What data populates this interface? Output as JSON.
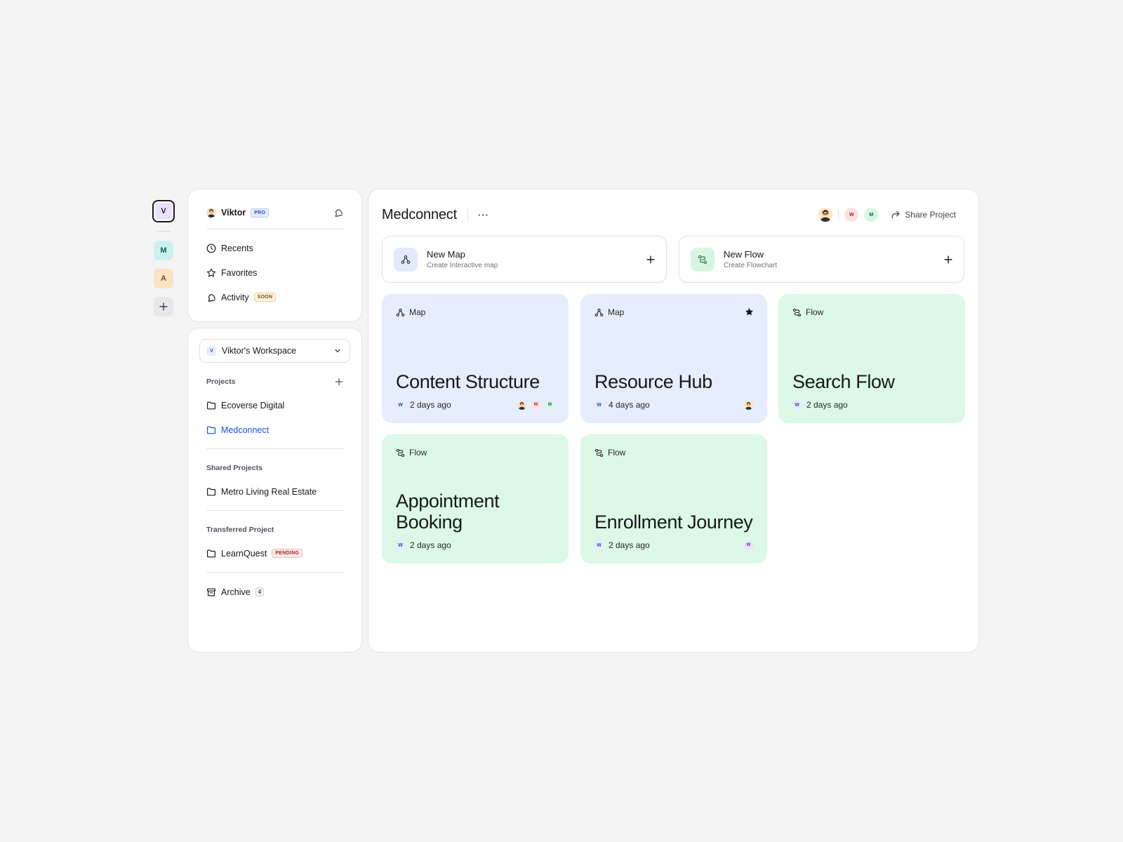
{
  "rail": {
    "workspaces": [
      {
        "initial": "V",
        "color": "#e9e1fb"
      },
      {
        "initial": "M",
        "color": "#cdf1f1"
      },
      {
        "initial": "A",
        "color": "#fbe3c4"
      }
    ],
    "add_icon": "plus-icon"
  },
  "sidebar": {
    "user": {
      "name": "Viktor",
      "plan_badge": "PRO",
      "notification_icon": "bell-icon"
    },
    "nav": [
      {
        "label": "Recents",
        "icon": "clock-icon"
      },
      {
        "label": "Favorites",
        "icon": "star-icon"
      },
      {
        "label": "Activity",
        "icon": "bell-icon",
        "badge": "SOON"
      }
    ],
    "workspace_select": {
      "initial": "V",
      "label": "Viktor's Workspace"
    },
    "projects": {
      "heading": "Projects",
      "items": [
        "Ecoverse Digital",
        "Medconnect"
      ],
      "active": "Medconnect"
    },
    "shared": {
      "heading": "Shared Projects",
      "items": [
        "Metro Living Real Estate"
      ]
    },
    "transferred": {
      "heading": "Transferred Project",
      "items": [
        {
          "label": "LearnQuest",
          "badge": "PENDING"
        }
      ]
    },
    "archive": {
      "label": "Archive",
      "count": "4"
    }
  },
  "main": {
    "title": "Medconnect",
    "more_label": "···",
    "collaborators": [
      "W",
      "M"
    ],
    "share_label": "Share Project",
    "actions": [
      {
        "title": "New Map",
        "subtitle": "Create Interactive map",
        "icon": "map-icon"
      },
      {
        "title": "New Flow",
        "subtitle": "Create Flowchart",
        "icon": "flow-icon"
      }
    ],
    "cards": [
      {
        "type": "Map",
        "title": "Content Structure",
        "workspace": "W",
        "time": "2 days ago",
        "avatars": [
          "photo",
          "W",
          "M"
        ],
        "starred": false
      },
      {
        "type": "Map",
        "title": "Resource Hub",
        "workspace": "W",
        "time": "4 days ago",
        "avatars": [
          "photo"
        ],
        "starred": true
      },
      {
        "type": "Flow",
        "title": "Search Flow",
        "workspace": "W",
        "time": "2 days ago",
        "avatars": [],
        "starred": false
      },
      {
        "type": "Flow",
        "title": "Appointment Booking",
        "workspace": "W",
        "time": "2 days ago",
        "avatars": [],
        "starred": false
      },
      {
        "type": "Flow",
        "title": "Enrollment Journey",
        "workspace": "W",
        "time": "2 days ago",
        "avatars": [
          "W"
        ],
        "starred": false
      }
    ]
  },
  "colors": {
    "accent": "#1d4ed8",
    "map_card": "#e6edfc",
    "flow_card": "#dcf8e7",
    "background": "#f4f4f5"
  }
}
